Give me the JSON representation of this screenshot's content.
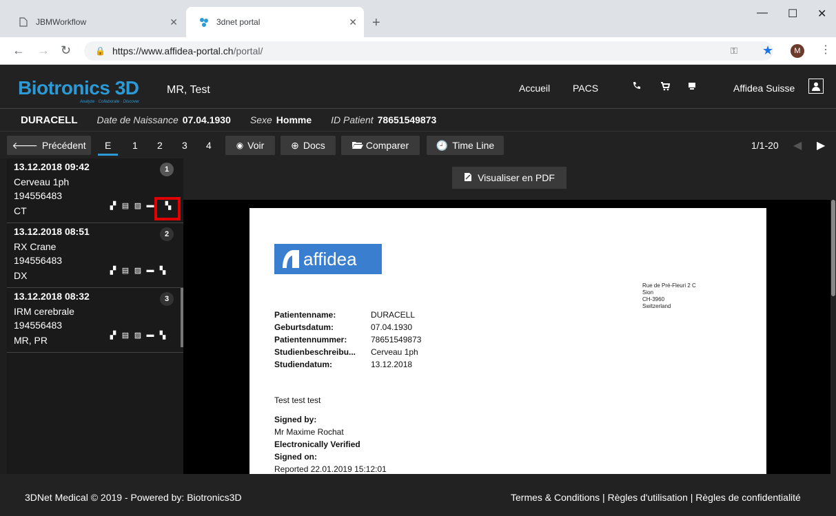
{
  "browser": {
    "tabs": [
      {
        "title": "JBMWorkflow",
        "active": false
      },
      {
        "title": "3dnet portal",
        "active": true
      }
    ],
    "url_host": "https://www.affidea-portal.ch",
    "url_path": "/portal/",
    "profile_initial": "M",
    "accent": "#1a73e8"
  },
  "header": {
    "brand": "Biotronics 3D",
    "tagline": "Analyze · Collaborate · Discover",
    "page_title": "MR, Test",
    "nav": [
      "Accueil",
      "PACS"
    ],
    "org": "Affidea Suisse",
    "icons": [
      "phone-icon",
      "cart-icon",
      "cart-full-icon",
      "user-icon"
    ],
    "brand_color": "#2b9ad6"
  },
  "patient": {
    "name": "DURACELL",
    "dob_label": "Date de Naissance",
    "dob": "07.04.1930",
    "sex_label": "Sexe",
    "sex": "Homme",
    "id_label": "ID Patient",
    "id": "78651549873"
  },
  "toolbar": {
    "prev": "Précédent",
    "tabs": [
      "E",
      "1",
      "2",
      "3",
      "4"
    ],
    "view": "Voir",
    "docs": "Docs",
    "compare": "Comparer",
    "timeline": "Time Line",
    "pager": "1/1-20"
  },
  "studies": [
    {
      "date": "13.12.2018 09:42",
      "desc": "Cerveau 1ph",
      "id": "194556483",
      "modality": "CT",
      "badge": "1"
    },
    {
      "date": "13.12.2018 08:51",
      "desc": "RX Crane",
      "id": "194556483",
      "modality": "DX",
      "badge": "2"
    },
    {
      "date": "13.12.2018 08:32",
      "desc": "IRM cerebrale",
      "id": "194556483",
      "modality": "MR, PR",
      "badge": "3"
    }
  ],
  "viewer": {
    "pdf_button": "Visualiser en PDF"
  },
  "report": {
    "logo_text": "affidea",
    "address": [
      "Rue de Pré-Fleuri 2 C",
      "Sion",
      "CH-3960",
      "Switzerland"
    ],
    "fields": [
      {
        "k": "Patientenname:",
        "v": "DURACELL"
      },
      {
        "k": "Geburtsdatum:",
        "v": "07.04.1930"
      },
      {
        "k": "Patientennummer:",
        "v": "78651549873"
      },
      {
        "k": "Studienbeschreibu...",
        "v": "Cerveau 1ph"
      },
      {
        "k": "Studiendatum:",
        "v": "13.12.2018"
      }
    ],
    "body": "Test test test",
    "signed_by_label": "Signed by:",
    "signed_by": "Mr Maxime Rochat",
    "verified": "Electronically Verified",
    "signed_on_label": "Signed on:",
    "reported": "Reported 22.01.2019 15:12:01"
  },
  "footer": {
    "left": "3DNet Medical © 2019 - Powered by: Biotronics3D",
    "right": "Termes & Conditions | Règles d'utilisation | Règles de confidentialité"
  }
}
